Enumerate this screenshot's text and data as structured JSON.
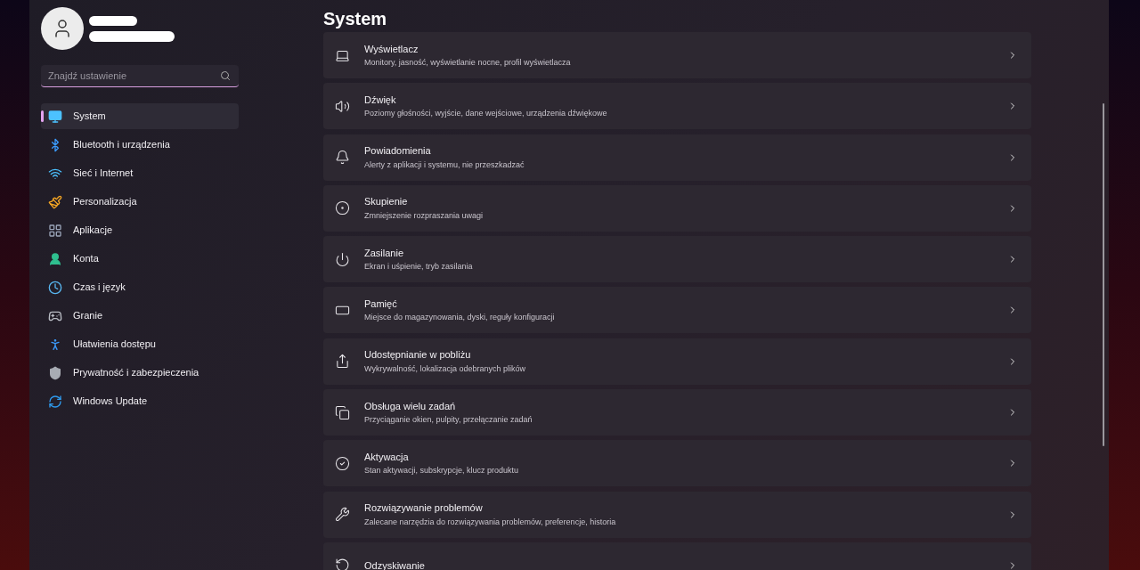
{
  "sidebar": {
    "search": {
      "placeholder": "Znajdź ustawienie"
    },
    "items": [
      {
        "label": "System",
        "selected": true
      },
      {
        "label": "Bluetooth i urządzenia",
        "selected": false
      },
      {
        "label": "Sieć i Internet",
        "selected": false
      },
      {
        "label": "Personalizacja",
        "selected": false
      },
      {
        "label": "Aplikacje",
        "selected": false
      },
      {
        "label": "Konta",
        "selected": false
      },
      {
        "label": "Czas i język",
        "selected": false
      },
      {
        "label": "Granie",
        "selected": false
      },
      {
        "label": "Ułatwienia dostępu",
        "selected": false
      },
      {
        "label": "Prywatność i zabezpieczenia",
        "selected": false
      },
      {
        "label": "Windows Update",
        "selected": false
      }
    ]
  },
  "page": {
    "title": "System",
    "cards": [
      {
        "title": "Wyświetlacz",
        "description": "Monitory, jasność, wyświetlanie nocne, profil wyświetlacza"
      },
      {
        "title": "Dźwięk",
        "description": "Poziomy głośności, wyjście, dane wejściowe, urządzenia dźwiękowe"
      },
      {
        "title": "Powiadomienia",
        "description": "Alerty z aplikacji i systemu, nie przeszkadzać"
      },
      {
        "title": "Skupienie",
        "description": "Zmniejszenie rozpraszania uwagi"
      },
      {
        "title": "Zasilanie",
        "description": "Ekran i uśpienie, tryb zasilania"
      },
      {
        "title": "Pamięć",
        "description": "Miejsce do magazynowania, dyski, reguły konfiguracji"
      },
      {
        "title": "Udostępnianie w pobliżu",
        "description": "Wykrywalność, lokalizacja odebranych plików"
      },
      {
        "title": "Obsługa wielu zadań",
        "description": "Przyciąganie okien, pulpity, przełączanie zadań"
      },
      {
        "title": "Aktywacja",
        "description": "Stan aktywacji, subskrypcje, klucz produktu"
      },
      {
        "title": "Rozwiązywanie problemów",
        "description": "Zalecane narzędzia do rozwiązywania problemów, preferencje, historia"
      },
      {
        "title": "Odzyskiwanie"
      }
    ]
  }
}
